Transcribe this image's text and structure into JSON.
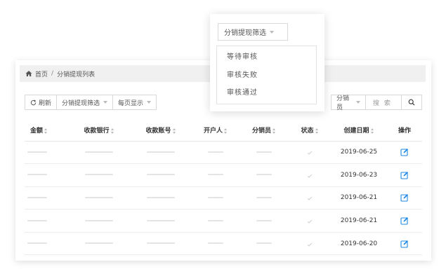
{
  "breadcrumb": {
    "home": "首页",
    "separator": "/",
    "current": "分销提现列表"
  },
  "toolbar": {
    "refresh": "刷新",
    "filter": "分销提现筛选",
    "per_page": "每页显示"
  },
  "search": {
    "seller": "分销员",
    "placeholder": "搜 索"
  },
  "table": {
    "headers": [
      "金额",
      "收款银行",
      "收款账号",
      "开户人",
      "分销员",
      "状态",
      "创建日期",
      "操作"
    ],
    "rows": [
      {
        "date": "2019-06-25"
      },
      {
        "date": "2019-06-23"
      },
      {
        "date": "2019-06-21"
      },
      {
        "date": "2019-06-21"
      },
      {
        "date": "2019-06-20"
      }
    ]
  },
  "dropdown": {
    "trigger": "分销提现筛选",
    "options": [
      "等待审核",
      "审核失败",
      "审核通过"
    ]
  },
  "icons": [
    "home-icon",
    "refresh-icon",
    "search-icon",
    "edit-icon",
    "chevron-down-icon"
  ],
  "colors": {
    "accent": "#1e88e5",
    "border": "#d8d8d8",
    "breadcrumb_bg": "#f0f0f0"
  }
}
